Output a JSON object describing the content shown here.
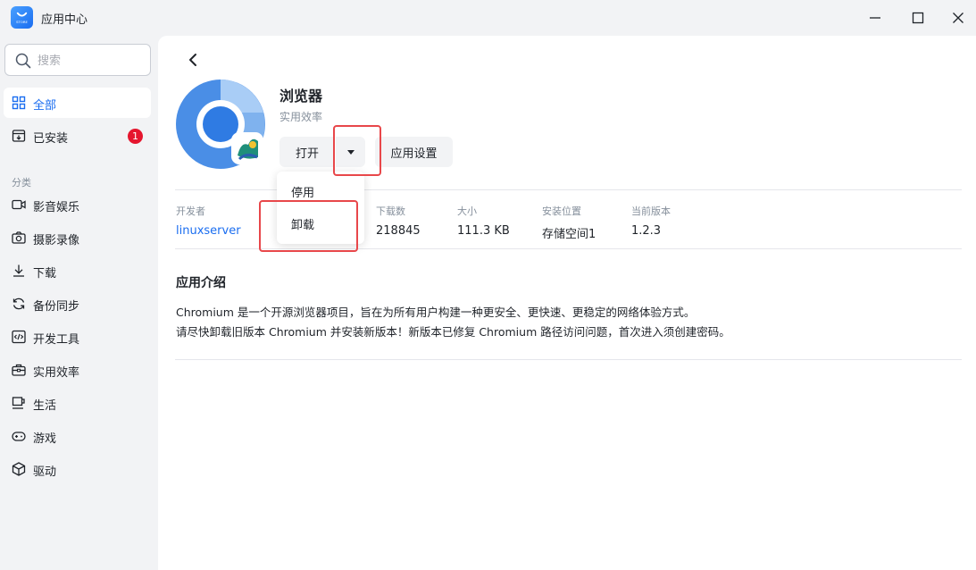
{
  "window": {
    "title": "应用中心",
    "logo_text": "STORE"
  },
  "sidebar": {
    "search_placeholder": "搜索",
    "items": [
      {
        "label": "全部",
        "icon": "grid-icon",
        "active": true
      },
      {
        "label": "已安装",
        "icon": "installed-box-icon",
        "badge": "1"
      }
    ],
    "category_label": "分类",
    "categories": [
      {
        "label": "影音娱乐",
        "icon": "video-camera-icon"
      },
      {
        "label": "摄影录像",
        "icon": "camera-icon"
      },
      {
        "label": "下载",
        "icon": "download-icon"
      },
      {
        "label": "备份同步",
        "icon": "sync-icon"
      },
      {
        "label": "开发工具",
        "icon": "code-icon"
      },
      {
        "label": "实用效率",
        "icon": "toolbox-icon"
      },
      {
        "label": "生活",
        "icon": "cup-icon"
      },
      {
        "label": "游戏",
        "icon": "gamepad-icon"
      },
      {
        "label": "驱动",
        "icon": "cube-icon"
      }
    ]
  },
  "app": {
    "name": "浏览器",
    "category": "实用效率",
    "open_label": "打开",
    "settings_label": "应用设置",
    "dropdown": [
      "停用",
      "卸载"
    ],
    "info": [
      {
        "key": "开发者",
        "value": "linuxserver"
      },
      {
        "key": "下载数",
        "value": "218845"
      },
      {
        "key": "大小",
        "value": "111.3 KB"
      },
      {
        "key": "安装位置",
        "value": "存储空间1"
      },
      {
        "key": "当前版本",
        "value": "1.2.3"
      }
    ],
    "intro_title": "应用介绍",
    "intro_lines": [
      "Chromium 是一个开源浏览器项目，旨在为所有用户构建一种更安全、更快速、更稳定的网络体验方式。",
      "请尽快卸载旧版本 Chromium 并安装新版本！新版本已修复 Chromium 路径访问问题，首次进入须创建密码。"
    ]
  },
  "colors": {
    "accent": "#1a6df0",
    "badge": "#e5162e",
    "highlight": "#e8474a"
  }
}
